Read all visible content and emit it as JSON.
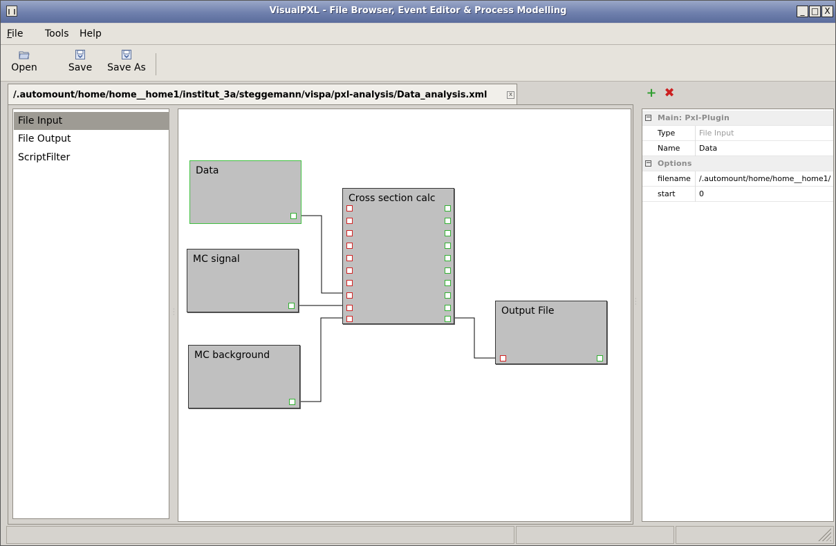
{
  "window": {
    "title": "VisualPXL - File Browser, Event Editor & Process Modelling",
    "controls": [
      "_",
      "□",
      "X"
    ]
  },
  "menu": [
    {
      "label": "File"
    },
    {
      "label": "Tools"
    },
    {
      "label": "Help"
    }
  ],
  "toolbar": {
    "open_label": "Open",
    "save_label": "Save",
    "saveas_label": "Save As"
  },
  "tab": {
    "label": "/.automount/home/home__home1/institut_3a/steggemann/vispa/pxl-analysis/Data_analysis.xml",
    "close_glyph": "x"
  },
  "plugins": [
    {
      "label": "File Input",
      "selected": true
    },
    {
      "label": "File Output",
      "selected": false
    },
    {
      "label": "ScriptFilter",
      "selected": false
    }
  ],
  "nodes": {
    "data": {
      "label": "Data"
    },
    "mc_signal": {
      "label": "MC signal"
    },
    "mc_background": {
      "label": "MC background"
    },
    "cross_section": {
      "label": "Cross section calc"
    },
    "output_file": {
      "label": "Output File"
    }
  },
  "properties": {
    "group_main": "Main: Pxl-Plugin",
    "type_key": "Type",
    "type_value": "File Input",
    "name_key": "Name",
    "name_value": "Data",
    "group_options": "Options",
    "filename_key": "filename",
    "filename_value": "/.automount/home/home__home1/",
    "start_key": "start",
    "start_value": "0"
  },
  "icons": {
    "add": "plus-icon",
    "remove": "delete-icon",
    "collapse": "minus-box-icon"
  },
  "colors": {
    "titlebar": "#6f80ad",
    "selected_node_border": "#3fbf3f",
    "input_port": "#d02020",
    "output_port": "#30b030",
    "add_icon": "#2f9e2f",
    "remove_icon": "#cc2020"
  }
}
